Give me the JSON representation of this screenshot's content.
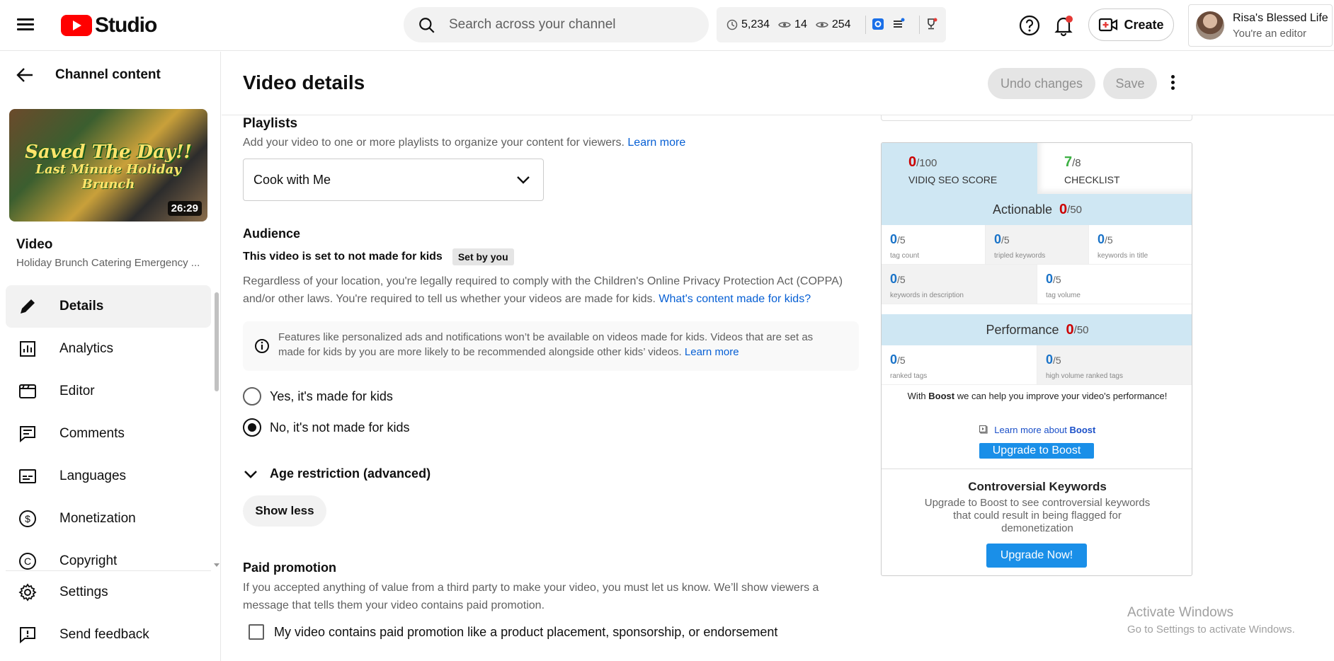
{
  "header": {
    "brand": "Studio",
    "search_placeholder": "Search across your channel",
    "stats": {
      "views": "5,234",
      "watching": "14",
      "recent": "254"
    },
    "create_label": "Create",
    "account": {
      "name": "Risa's Blessed Life",
      "role": "You're an editor"
    }
  },
  "sidebar": {
    "back_label": "Channel content",
    "thumbnail": {
      "line1": "Saved The Day!!",
      "line2": "Last Minute Holiday Brunch",
      "duration": "26:29"
    },
    "video_label": "Video",
    "video_title": "Holiday Brunch Catering Emergency ...",
    "items": [
      {
        "label": "Details",
        "icon": "pencil-icon",
        "active": true
      },
      {
        "label": "Analytics",
        "icon": "analytics-icon"
      },
      {
        "label": "Editor",
        "icon": "editor-icon"
      },
      {
        "label": "Comments",
        "icon": "comments-icon"
      },
      {
        "label": "Languages",
        "icon": "subtitles-icon"
      },
      {
        "label": "Monetization",
        "icon": "dollar-icon"
      },
      {
        "label": "Copyright",
        "icon": "copyright-icon"
      }
    ],
    "bottom": [
      {
        "label": "Settings",
        "icon": "gear-icon"
      },
      {
        "label": "Send feedback",
        "icon": "feedback-icon"
      }
    ]
  },
  "main": {
    "title": "Video details",
    "undo_label": "Undo changes",
    "save_label": "Save",
    "playlists": {
      "title": "Playlists",
      "text": "Add your video to one or more playlists to organize your content for viewers.",
      "link": "Learn more",
      "selected": "Cook with Me"
    },
    "audience": {
      "title": "Audience",
      "status": "This video is set to not made for kids",
      "badge": "Set by you",
      "text1": "Regardless of your location, you're legally required to comply with the Children's Online Privacy Protection Act (COPPA)",
      "text2": "and/or other laws. You're required to tell us whether your videos are made for kids.",
      "link": "What's content made for kids?",
      "info1": "Features like personalized ads and notifications won’t be available on videos made for kids. Videos that are set as",
      "info2": "made for kids by you are more likely to be recommended alongside other kids’ videos.",
      "info_link": "Learn more",
      "opt_yes": "Yes, it's made for kids",
      "opt_no": "No, it's not made for kids"
    },
    "age_restriction": "Age restriction (advanced)",
    "show_less": "Show less",
    "paid": {
      "title": "Paid promotion",
      "text1": "If you accepted anything of value from a third party to make your video, you must let us know. We’ll show viewers a",
      "text2": "message that tells them your video contains paid promotion.",
      "checkbox": "My video contains paid promotion like a product placement, sponsorship, or endorsement"
    }
  },
  "vidiq": {
    "seo": {
      "value": "0",
      "max": "/100",
      "label": "VIDIQ SEO SCORE"
    },
    "checklist": {
      "value": "7",
      "max": "/8",
      "label": "CHECKLIST"
    },
    "actionable": {
      "label": "Actionable",
      "value": "0",
      "max": "/50"
    },
    "performance": {
      "label": "Performance",
      "value": "0",
      "max": "/50"
    },
    "metrics": [
      {
        "value": "0",
        "max": "/5",
        "label": "tag count"
      },
      {
        "value": "0",
        "max": "/5",
        "label": "tripled keywords"
      },
      {
        "value": "0",
        "max": "/5",
        "label": "keywords in title"
      },
      {
        "value": "0",
        "max": "/5",
        "label": "keywords in description"
      },
      {
        "value": "0",
        "max": "/5",
        "label": "tag volume"
      },
      {
        "value": "0",
        "max": "/5",
        "label": "ranked tags"
      },
      {
        "value": "0",
        "max": "/5",
        "label": "high volume ranked tags"
      }
    ],
    "boost_pre": "With",
    "boost_bold": "Boost",
    "boost_post": "we can help you improve your video's performance!",
    "learn_pre": "Learn more about",
    "learn_bold": "Boost",
    "upgrade_boost": "Upgrade to Boost",
    "controversial_title": "Controversial Keywords",
    "controversial_text": "Upgrade to Boost to see controversial keywords that could result in being flagged for demonetization",
    "upgrade_now": "Upgrade Now!"
  },
  "watermark": {
    "line1": "Activate Windows",
    "line2": "Go to Settings to activate Windows."
  }
}
